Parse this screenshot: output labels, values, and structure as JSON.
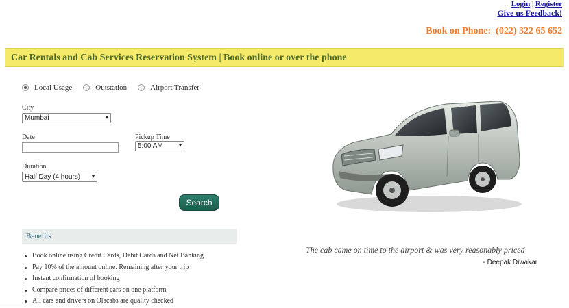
{
  "header": {
    "login": "Login",
    "separator": "|",
    "register": "Register",
    "feedback": "Give us Feedback!",
    "phone_label": "Book on Phone:",
    "phone_number": "(022)  322 65 652"
  },
  "banner": {
    "title": "Car Rentals and Cab Services Reservation System | Book online or over the phone"
  },
  "trip_types": [
    {
      "label": "Local Usage",
      "selected": true
    },
    {
      "label": "Outstation",
      "selected": false
    },
    {
      "label": "Airport Transfer",
      "selected": false
    }
  ],
  "form": {
    "city_label": "City",
    "city_value": "Mumbai",
    "date_label": "Date",
    "date_value": "",
    "pickup_label": "Pickup Time",
    "pickup_value": "5:00 AM",
    "duration_label": "Duration",
    "duration_value": "Half Day (4 hours)",
    "search": "Search"
  },
  "benefits": {
    "title": "Benefits",
    "items": [
      "Book online using Credit Cards, Debit Cards and Net Banking",
      "Pay 10% of the amount online. Remaining after your trip",
      "Instant confirmation of booking",
      "Compare prices of different cars on one platform",
      "All cars and drivers on Olacabs are quality checked"
    ]
  },
  "testimonial": {
    "quote": "The cab came on time to the airport & was very reasonably priced",
    "author": "- Deepak Diwakar"
  },
  "colors": {
    "banner_bg": "#f6ea6a",
    "banner_text": "#4b6a2c",
    "phone": "#f07b2a",
    "link": "#1a1aa8",
    "button": "#1f6453",
    "benefits_head": "#3f6e82"
  },
  "icons": {
    "select_caret": "▾",
    "car_image": "silver-minivan"
  }
}
